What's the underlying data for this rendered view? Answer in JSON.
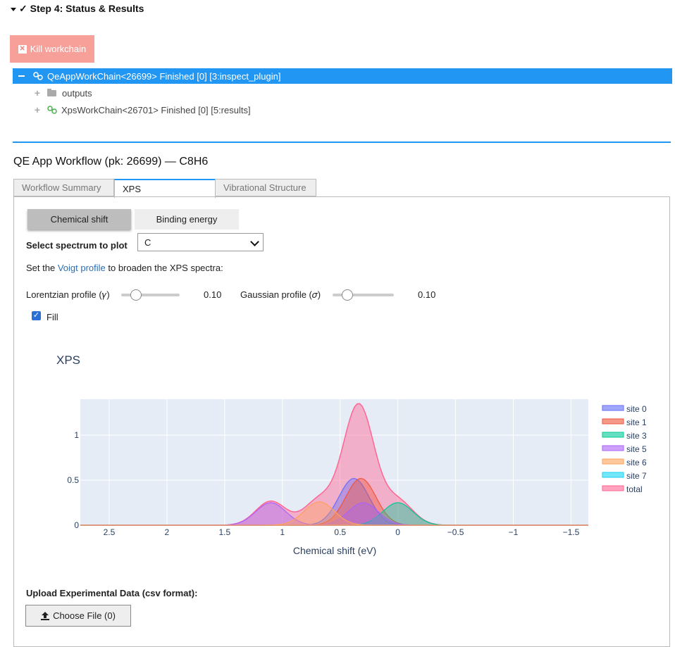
{
  "step": {
    "title": "✓ Step 4: Status & Results"
  },
  "kill_button": {
    "label": "Kill workchain"
  },
  "tree": {
    "root": "QeAppWorkChain<26699> Finished [0] [3:inspect_plugin]",
    "children": [
      {
        "label": "outputs",
        "icon": "folder-icon"
      },
      {
        "label": "XpsWorkChain<26701> Finished [0] [5:results]",
        "icon": "link-icon"
      }
    ]
  },
  "workflow_title": "QE App Workflow (pk: 26699) — C8H6",
  "tabs": [
    {
      "label": "Workflow Summary",
      "active": false
    },
    {
      "label": "XPS",
      "active": true
    },
    {
      "label": "Vibrational Structure",
      "active": false
    }
  ],
  "toggles": [
    {
      "label": "Chemical shift",
      "selected": true
    },
    {
      "label": "Binding energy",
      "selected": false
    }
  ],
  "spectrum_select": {
    "label": "Select spectrum to plot",
    "value": "C"
  },
  "voigt_text": {
    "before": "Set the ",
    "link": "Voigt profile",
    "after": " to broaden the XPS spectra:"
  },
  "sliders": [
    {
      "label": "Lorentzian profile (𝛾)",
      "value": "0.10"
    },
    {
      "label": "Gaussian profile (𝜎)",
      "value": "0.10"
    }
  ],
  "fill": {
    "label": "Fill",
    "checked": true
  },
  "upload": {
    "label": "Upload Experimental Data (csv format):",
    "button": "Choose File (0)"
  },
  "colors": {
    "accent": "#2196f3",
    "kill": "#f7a09a"
  },
  "chart_data": {
    "type": "area",
    "title": "XPS",
    "xlabel": "Chemical shift (eV)",
    "ylabel": "",
    "xlim": [
      2.75,
      -1.65
    ],
    "ylim": [
      0,
      1.4
    ],
    "xticks": [
      "2.5",
      "2",
      "1.5",
      "1",
      "0.5",
      "0",
      "−0.5",
      "−1",
      "−1.5"
    ],
    "xtick_values": [
      2.5,
      2,
      1.5,
      1,
      0.5,
      0,
      -0.5,
      -1,
      -1.5
    ],
    "yticks": [
      "0",
      "0.5",
      "1"
    ],
    "ytick_values": [
      0,
      0.5,
      1
    ],
    "legend_position": "right",
    "series": [
      {
        "name": "site 0",
        "color": "#636efa",
        "peaks": [
          {
            "x": 0.38,
            "h": 0.52
          }
        ]
      },
      {
        "name": "site 1",
        "color": "#ef553b",
        "peaks": [
          {
            "x": 0.32,
            "h": 0.52
          }
        ]
      },
      {
        "name": "site 3",
        "color": "#00cc96",
        "peaks": [
          {
            "x": 0.0,
            "h": 0.25
          }
        ]
      },
      {
        "name": "site 5",
        "color": "#ab63fa",
        "peaks": [
          {
            "x": 1.1,
            "h": 0.25
          },
          {
            "x": 0.3,
            "h": 0.25
          }
        ]
      },
      {
        "name": "site 6",
        "color": "#ffa15a",
        "peaks": [
          {
            "x": 0.68,
            "h": 0.26
          }
        ]
      },
      {
        "name": "site 7",
        "color": "#19d3f3",
        "peaks": []
      },
      {
        "name": "total",
        "color": "#ff6692",
        "peaks": []
      }
    ],
    "total_peak": 1.35
  }
}
